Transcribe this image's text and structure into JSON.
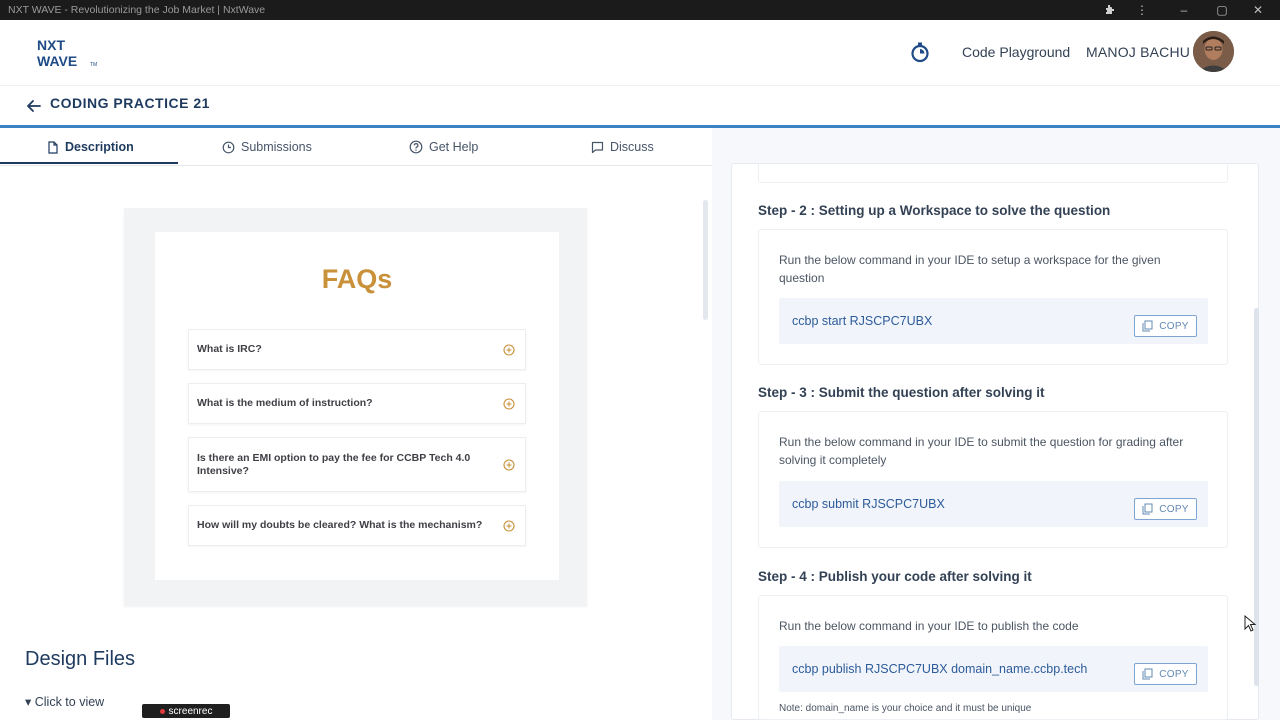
{
  "window": {
    "title": "NXT WAVE - Revolutionizing the Job Market | NxtWave"
  },
  "header": {
    "logo_line1": "NXT",
    "logo_line2": "WAVE",
    "logo_tm": "TM",
    "playground_label": "Code Playground",
    "user_name": "MANOJ BACHU"
  },
  "subheader": {
    "title": "CODING PRACTICE 21"
  },
  "tabs": [
    {
      "label": "Description",
      "icon": "document-icon",
      "active": true
    },
    {
      "label": "Submissions",
      "icon": "clock-icon",
      "active": false
    },
    {
      "label": "Get Help",
      "icon": "help-circle-icon",
      "active": false
    },
    {
      "label": "Discuss",
      "icon": "chat-icon",
      "active": false
    }
  ],
  "faq": {
    "title": "FAQs",
    "items": [
      "What is IRC?",
      "What is the medium of instruction?",
      "Is there an EMI option to pay the fee for CCBP Tech 4.0 Intensive?",
      "How will my doubts be cleared? What is the mechanism?"
    ]
  },
  "design_files": {
    "heading": "Design Files",
    "toggle": "▾ Click to view"
  },
  "overlay": {
    "screenrec": "screenrec"
  },
  "steps": [
    {
      "title": "Step - 2 : Setting up a Workspace to solve the question",
      "description": "Run the below command in your IDE to setup a workspace for the given question",
      "command": "ccbp start RJSCPC7UBX",
      "copy_label": "COPY"
    },
    {
      "title": "Step - 3 : Submit the question after solving it",
      "description": "Run the below command in your IDE to submit the question for grading after solving it completely",
      "command": "ccbp submit RJSCPC7UBX",
      "copy_label": "COPY"
    },
    {
      "title": "Step - 4 : Publish your code after solving it",
      "description": "Run the below command in your IDE to publish the code",
      "command": "ccbp publish RJSCPC7UBX domain_name.ccbp.tech",
      "copy_label": "COPY",
      "note": "Note: domain_name is your choice and it must be unique"
    }
  ],
  "colors": {
    "accent_blue": "#3b82c4",
    "navy": "#1e3a5f",
    "faq_gold": "#c8913a",
    "command_text": "#2d5b9a"
  }
}
